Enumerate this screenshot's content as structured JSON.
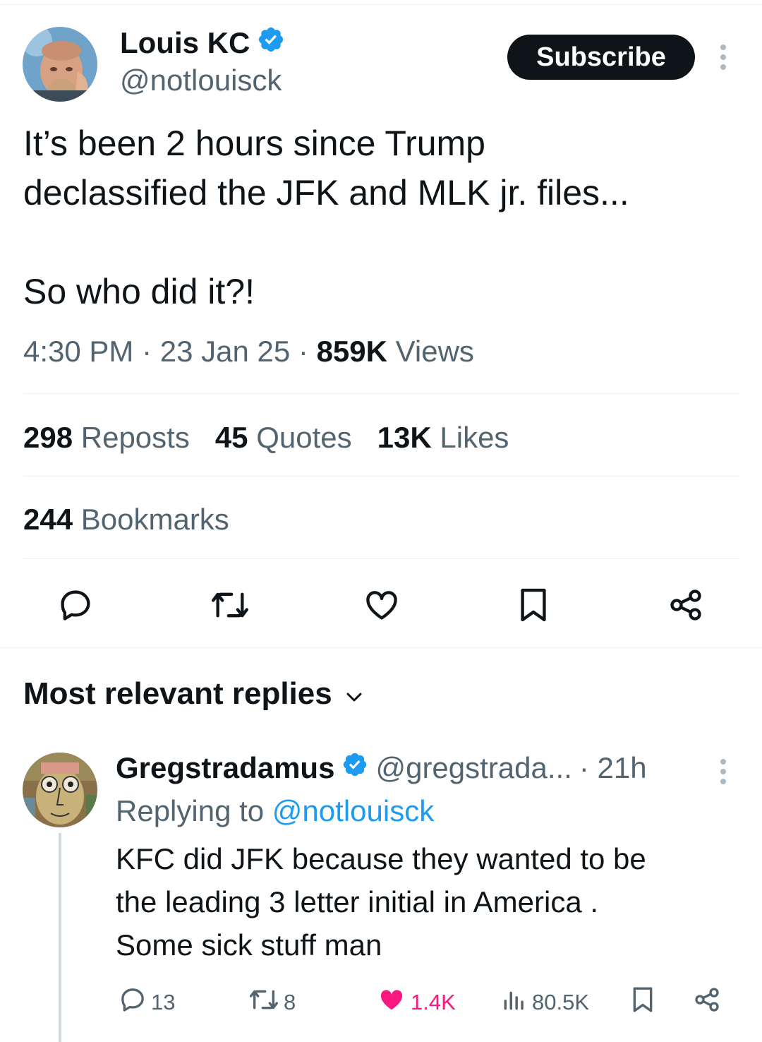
{
  "tweet": {
    "author_name": "Louis KC",
    "author_handle": "@notlouisck",
    "subscribe_label": "Subscribe",
    "text": "It’s been 2 hours since Trump\ndeclassified the JFK and MLK jr. files...\n\nSo who did it?!",
    "time": "4:30 PM",
    "date": "23 Jan 25",
    "views_count": "859K",
    "views_label": "Views",
    "reposts_count": "298",
    "reposts_label": "Reposts",
    "quotes_count": "45",
    "quotes_label": "Quotes",
    "likes_count": "13K",
    "likes_label": "Likes",
    "bookmarks_count": "244",
    "bookmarks_label": "Bookmarks"
  },
  "replies_header": "Most relevant replies",
  "reply": {
    "author_name": "Gregstradamus",
    "author_handle": "@gregstrada...",
    "time": "· 21h",
    "replying_prefix": "Replying to",
    "replying_handle": "@notlouisck",
    "text": "KFC did JFK because they wanted to be\nthe leading 3 letter initial in America .\nSome sick stuff man",
    "replies": "13",
    "reposts": "8",
    "likes": "1.4K",
    "views": "80.5K"
  },
  "colors": {
    "verified": "#1d9bf0",
    "like_pink": "#f91880",
    "secondary_text": "#536471",
    "primary_text": "#0f1419",
    "divider": "#eff3f4"
  },
  "icons": [
    "verified-badge-icon",
    "more-icon",
    "reply-icon",
    "repost-icon",
    "like-icon",
    "bookmark-icon",
    "share-icon",
    "chevron-down-icon",
    "views-icon"
  ]
}
